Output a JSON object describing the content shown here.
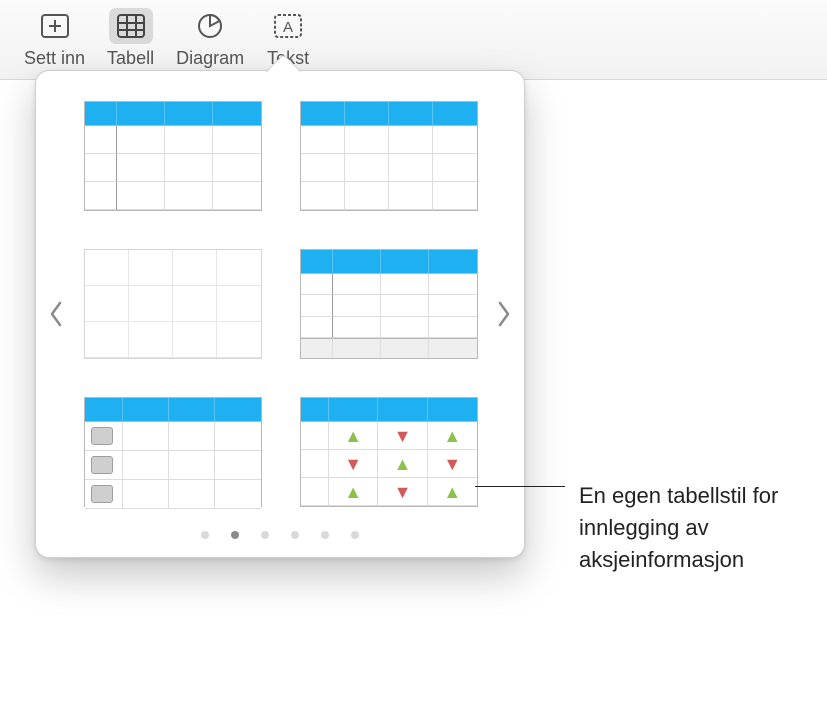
{
  "toolbar": {
    "items": [
      {
        "label": "Sett inn",
        "icon": "insert-icon",
        "active": false
      },
      {
        "label": "Tabell",
        "icon": "table-icon",
        "active": true
      },
      {
        "label": "Diagram",
        "icon": "chart-icon",
        "active": false
      },
      {
        "label": "Tekst",
        "icon": "text-icon",
        "active": false
      }
    ]
  },
  "popover": {
    "page_count": 6,
    "active_page_index": 1,
    "styles": [
      {
        "name": "table-style-header-rowcolumn"
      },
      {
        "name": "table-style-header-only"
      },
      {
        "name": "table-style-plain-grid"
      },
      {
        "name": "table-style-header-footer"
      },
      {
        "name": "table-style-checklist"
      },
      {
        "name": "table-style-stocks"
      }
    ]
  },
  "callout": {
    "text": "En egen tabellstil for innlegging av aksjeinformasjon"
  },
  "colors": {
    "accent": "#1EB0F0",
    "up": "#8BC34A",
    "down": "#D45A5A"
  }
}
